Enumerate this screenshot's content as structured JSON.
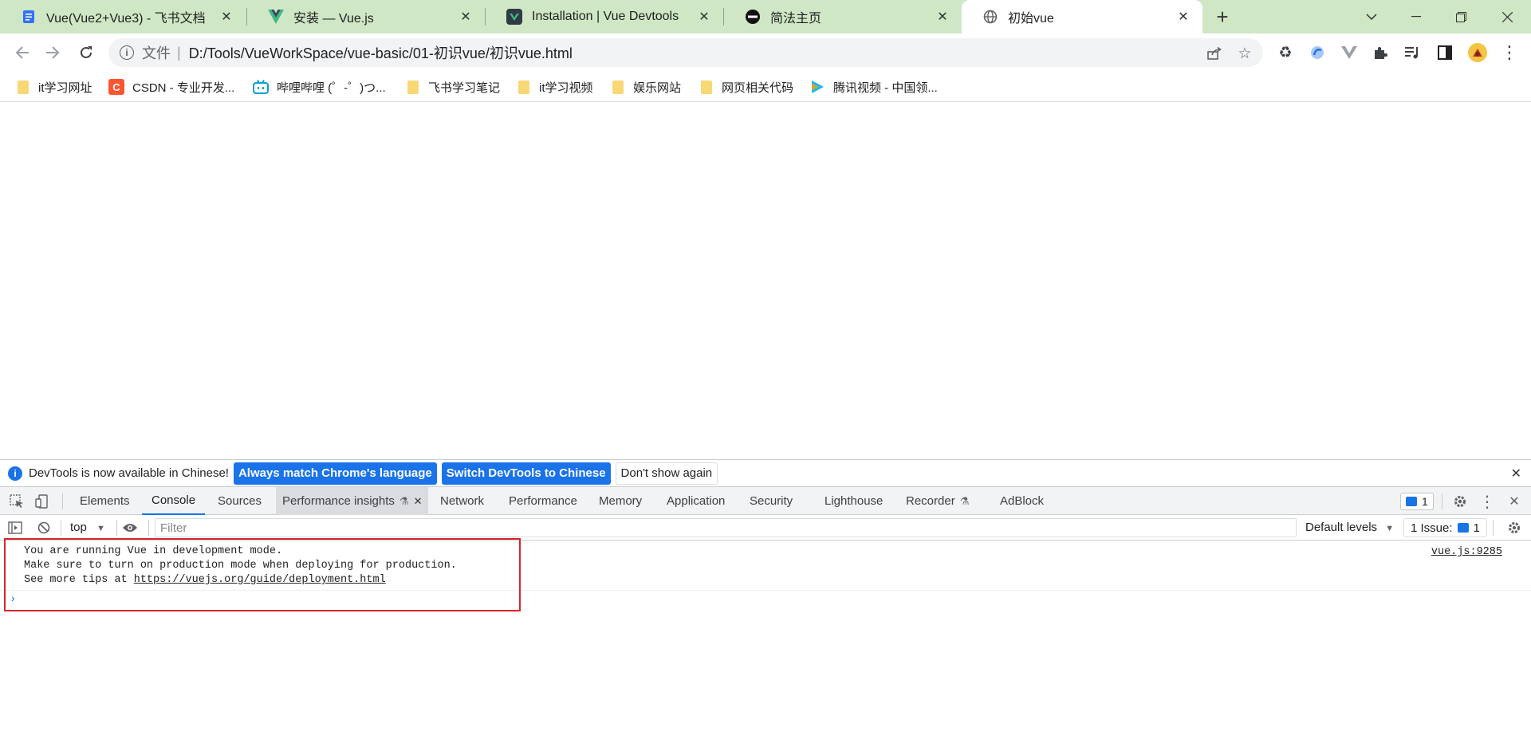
{
  "browser": {
    "tabs": [
      {
        "title": "Vue(Vue2+Vue3) - 飞书文档",
        "icon": "feishu-doc-icon"
      },
      {
        "title": "安装 — Vue.js",
        "icon": "vue-logo-icon"
      },
      {
        "title": "Installation | Vue Devtools",
        "icon": "vue-devtools-icon"
      },
      {
        "title": "简法主页",
        "icon": "jianfa-icon"
      },
      {
        "title": "初始vue",
        "icon": "globe-icon"
      }
    ],
    "address": {
      "scheme_label": "文件",
      "url": "D:/Tools/VueWorkSpace/vue-basic/01-初识vue/初识vue.html"
    },
    "bookmarks": [
      {
        "label": "it学习网址",
        "icon": "folder-icon"
      },
      {
        "label": "CSDN - 专业开发...",
        "icon": "csdn-icon"
      },
      {
        "label": "哔哩哔哩 (゜-゜)つ...",
        "icon": "bilibili-icon"
      },
      {
        "label": "飞书学习笔记",
        "icon": "folder-icon"
      },
      {
        "label": "it学习视频",
        "icon": "folder-icon"
      },
      {
        "label": "娱乐网站",
        "icon": "folder-icon"
      },
      {
        "label": "网页相关代码",
        "icon": "folder-icon"
      },
      {
        "label": "腾讯视频 - 中国领...",
        "icon": "tencent-video-icon"
      }
    ]
  },
  "devtools": {
    "infobar": {
      "message": "DevTools is now available in Chinese!",
      "btn_match": "Always match Chrome's language",
      "btn_switch": "Switch DevTools to Chinese",
      "btn_dismiss": "Don't show again"
    },
    "tabs": [
      "Elements",
      "Console",
      "Sources",
      "Performance insights",
      "Network",
      "Performance",
      "Memory",
      "Application",
      "Security",
      "Lighthouse",
      "Recorder",
      "AdBlock"
    ],
    "messages_badge": "1",
    "console_toolbar": {
      "context": "top",
      "filter_placeholder": "Filter",
      "levels": "Default levels",
      "issues_label": "1 Issue:",
      "issues_count": "1"
    },
    "log": {
      "line1": "You are running Vue in development mode.",
      "line2": "Make sure to turn on production mode when deploying for production.",
      "line3_prefix": "See more tips at ",
      "line3_link": "https://vuejs.org/guide/deployment.html",
      "source": "vue.js:9285"
    },
    "colors": {
      "accent": "#1a73e8",
      "highlight_box": "#d9252c"
    }
  }
}
